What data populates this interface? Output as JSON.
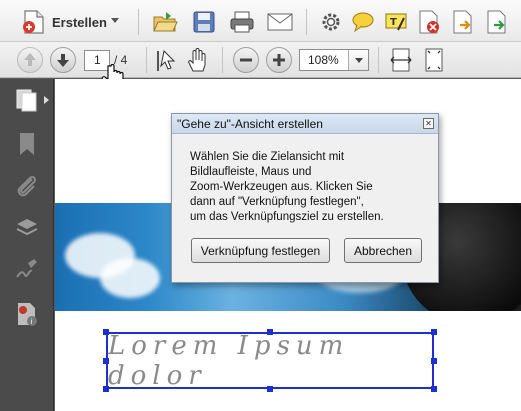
{
  "toolbar": {
    "create_label": "Erstellen",
    "icons": [
      "open-folder-icon",
      "save-icon",
      "print-icon",
      "email-icon",
      "gear-icon",
      "comment-icon",
      "highlight-text-icon",
      "delete-pdf-icon",
      "export-pdf-icon",
      "share-pdf-icon"
    ]
  },
  "navbar": {
    "page_current": "1",
    "page_total": "/ 4",
    "cursor_badge": "1",
    "zoom": "108%"
  },
  "document": {
    "lorem_text": "Lorem Ipsum dolor"
  },
  "dialog": {
    "title": "\"Gehe zu\"-Ansicht erstellen",
    "message_lines": [
      "Wählen Sie die Zielansicht mit",
      "Bildlaufleiste, Maus und",
      "Zoom-Werkzeugen aus. Klicken Sie",
      "dann auf \"Verknüpfung festlegen\",",
      "um das Verknüpfungsziel zu erstellen."
    ],
    "confirm_label": "Verknüpfung festlegen",
    "cancel_label": "Abbrechen"
  },
  "colors": {
    "selection": "#1d2fd1",
    "sidebar": "#4b4b4b"
  }
}
